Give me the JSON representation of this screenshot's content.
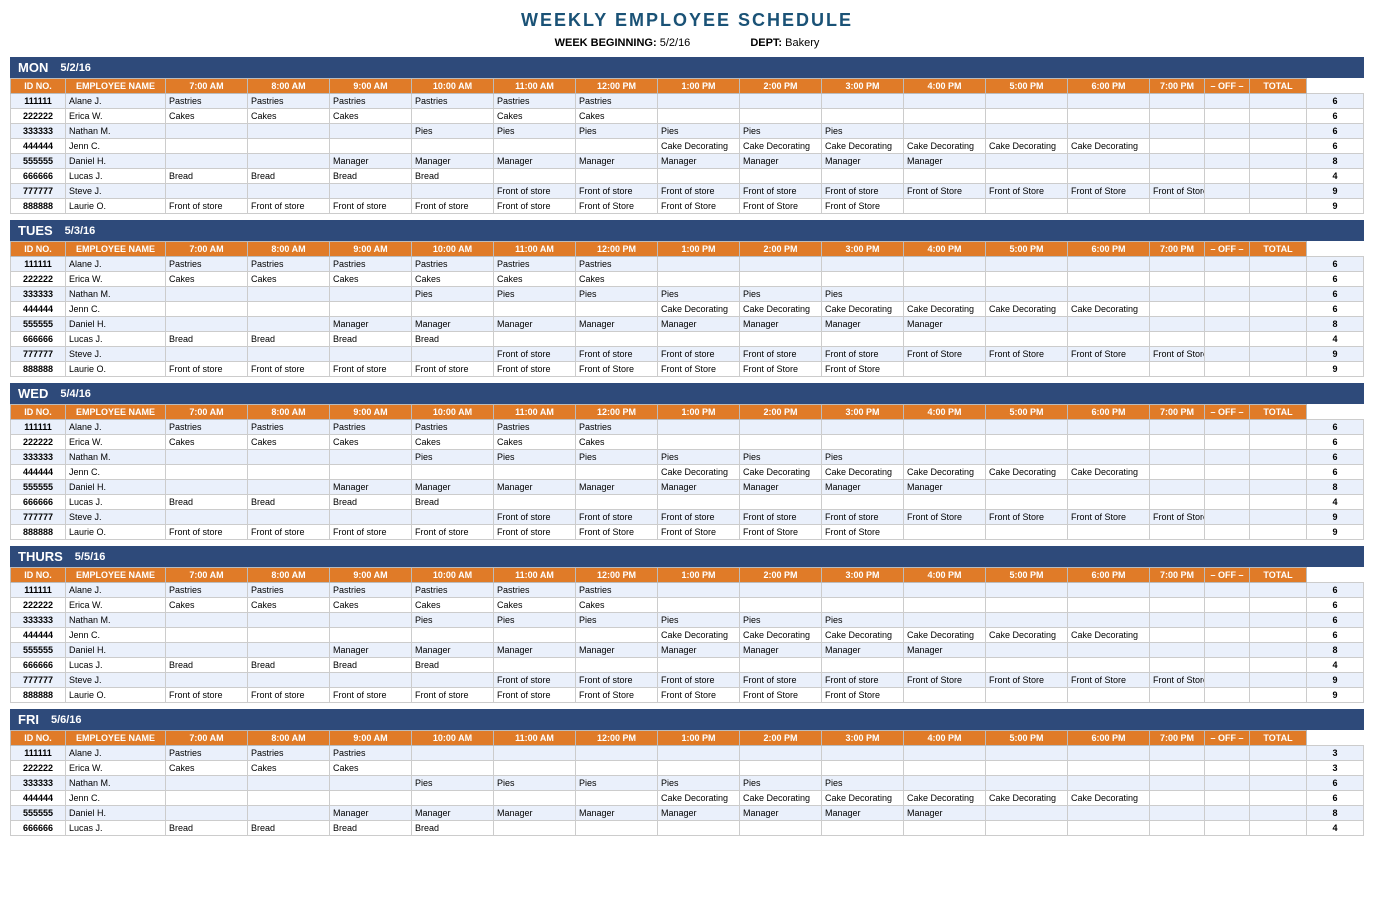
{
  "title": "WEEKLY EMPLOYEE SCHEDULE",
  "meta": {
    "week_label": "WEEK BEGINNING:",
    "week_value": "5/2/16",
    "dept_label": "DEPT:",
    "dept_value": "Bakery"
  },
  "columns": [
    "ID NO.",
    "EMPLOYEE NAME",
    "7:00 AM",
    "8:00 AM",
    "9:00 AM",
    "10:00 AM",
    "11:00 AM",
    "12:00 PM",
    "1:00 PM",
    "2:00 PM",
    "3:00 PM",
    "4:00 PM",
    "5:00 PM",
    "6:00 PM",
    "7:00 PM",
    "– OFF –",
    "TOTAL"
  ],
  "days": [
    {
      "name": "MON",
      "date": "5/2/16",
      "rows": [
        {
          "id": "111111",
          "name": "Alane J.",
          "slots": [
            "Pastries",
            "Pastries",
            "Pastries",
            "Pastries",
            "Pastries",
            "Pastries",
            "",
            "",
            "",
            "",
            "",
            "",
            "",
            ""
          ],
          "off": "",
          "total": "6"
        },
        {
          "id": "222222",
          "name": "Erica W.",
          "slots": [
            "Cakes",
            "Cakes",
            "Cakes",
            "",
            "Cakes",
            "Cakes",
            "",
            "",
            "",
            "",
            "",
            "",
            "",
            ""
          ],
          "off": "",
          "total": "6"
        },
        {
          "id": "333333",
          "name": "Nathan M.",
          "slots": [
            "",
            "",
            "",
            "Pies",
            "Pies",
            "Pies",
            "Pies",
            "Pies",
            "Pies",
            "",
            "",
            "",
            "",
            ""
          ],
          "off": "",
          "total": "6"
        },
        {
          "id": "444444",
          "name": "Jenn C.",
          "slots": [
            "",
            "",
            "",
            "",
            "",
            "",
            "Cake Decorating",
            "Cake Decorating",
            "Cake Decorating",
            "Cake Decorating",
            "Cake Decorating",
            "Cake Decorating",
            "",
            ""
          ],
          "off": "",
          "total": "6"
        },
        {
          "id": "555555",
          "name": "Daniel H.",
          "slots": [
            "",
            "",
            "Manager",
            "Manager",
            "Manager",
            "Manager",
            "Manager",
            "Manager",
            "Manager",
            "Manager",
            "",
            "",
            "",
            ""
          ],
          "off": "",
          "total": "8"
        },
        {
          "id": "666666",
          "name": "Lucas J.",
          "slots": [
            "Bread",
            "Bread",
            "Bread",
            "Bread",
            "",
            "",
            "",
            "",
            "",
            "",
            "",
            "",
            "",
            ""
          ],
          "off": "",
          "total": "4"
        },
        {
          "id": "777777",
          "name": "Steve J.",
          "slots": [
            "",
            "",
            "",
            "",
            "Front of store",
            "Front of store",
            "Front of store",
            "Front of store",
            "Front of store",
            "Front of Store",
            "Front of Store",
            "Front of Store",
            "Front of Store",
            ""
          ],
          "off": "",
          "total": "9"
        },
        {
          "id": "888888",
          "name": "Laurie O.",
          "slots": [
            "Front of store",
            "Front of store",
            "Front of store",
            "Front of store",
            "Front of store",
            "Front of Store",
            "Front of Store",
            "Front of Store",
            "Front of Store",
            "",
            "",
            "",
            "",
            ""
          ],
          "off": "",
          "total": "9"
        }
      ]
    },
    {
      "name": "TUES",
      "date": "5/3/16",
      "rows": [
        {
          "id": "111111",
          "name": "Alane J.",
          "slots": [
            "Pastries",
            "Pastries",
            "Pastries",
            "Pastries",
            "Pastries",
            "Pastries",
            "",
            "",
            "",
            "",
            "",
            "",
            "",
            ""
          ],
          "off": "",
          "total": "6"
        },
        {
          "id": "222222",
          "name": "Erica W.",
          "slots": [
            "Cakes",
            "Cakes",
            "Cakes",
            "Cakes",
            "Cakes",
            "Cakes",
            "",
            "",
            "",
            "",
            "",
            "",
            "",
            ""
          ],
          "off": "",
          "total": "6"
        },
        {
          "id": "333333",
          "name": "Nathan M.",
          "slots": [
            "",
            "",
            "",
            "Pies",
            "Pies",
            "Pies",
            "Pies",
            "Pies",
            "Pies",
            "",
            "",
            "",
            "",
            ""
          ],
          "off": "",
          "total": "6"
        },
        {
          "id": "444444",
          "name": "Jenn C.",
          "slots": [
            "",
            "",
            "",
            "",
            "",
            "",
            "Cake Decorating",
            "Cake Decorating",
            "Cake Decorating",
            "Cake Decorating",
            "Cake Decorating",
            "Cake Decorating",
            "",
            ""
          ],
          "off": "",
          "total": "6"
        },
        {
          "id": "555555",
          "name": "Daniel H.",
          "slots": [
            "",
            "",
            "Manager",
            "Manager",
            "Manager",
            "Manager",
            "Manager",
            "Manager",
            "Manager",
            "Manager",
            "",
            "",
            "",
            ""
          ],
          "off": "",
          "total": "8"
        },
        {
          "id": "666666",
          "name": "Lucas J.",
          "slots": [
            "Bread",
            "Bread",
            "Bread",
            "Bread",
            "",
            "",
            "",
            "",
            "",
            "",
            "",
            "",
            "",
            ""
          ],
          "off": "",
          "total": "4"
        },
        {
          "id": "777777",
          "name": "Steve J.",
          "slots": [
            "",
            "",
            "",
            "",
            "Front of store",
            "Front of store",
            "Front of store",
            "Front of store",
            "Front of store",
            "Front of Store",
            "Front of Store",
            "Front of Store",
            "Front of Store",
            ""
          ],
          "off": "",
          "total": "9"
        },
        {
          "id": "888888",
          "name": "Laurie O.",
          "slots": [
            "Front of store",
            "Front of store",
            "Front of store",
            "Front of store",
            "Front of store",
            "Front of Store",
            "Front of Store",
            "Front of Store",
            "Front of Store",
            "",
            "",
            "",
            "",
            ""
          ],
          "off": "",
          "total": "9"
        }
      ]
    },
    {
      "name": "WED",
      "date": "5/4/16",
      "rows": [
        {
          "id": "111111",
          "name": "Alane J.",
          "slots": [
            "Pastries",
            "Pastries",
            "Pastries",
            "Pastries",
            "Pastries",
            "Pastries",
            "",
            "",
            "",
            "",
            "",
            "",
            "",
            ""
          ],
          "off": "",
          "total": "6"
        },
        {
          "id": "222222",
          "name": "Erica W.",
          "slots": [
            "Cakes",
            "Cakes",
            "Cakes",
            "Cakes",
            "Cakes",
            "Cakes",
            "",
            "",
            "",
            "",
            "",
            "",
            "",
            ""
          ],
          "off": "",
          "total": "6"
        },
        {
          "id": "333333",
          "name": "Nathan M.",
          "slots": [
            "",
            "",
            "",
            "Pies",
            "Pies",
            "Pies",
            "Pies",
            "Pies",
            "Pies",
            "",
            "",
            "",
            "",
            ""
          ],
          "off": "",
          "total": "6"
        },
        {
          "id": "444444",
          "name": "Jenn C.",
          "slots": [
            "",
            "",
            "",
            "",
            "",
            "",
            "Cake Decorating",
            "Cake Decorating",
            "Cake Decorating",
            "Cake Decorating",
            "Cake Decorating",
            "Cake Decorating",
            "",
            ""
          ],
          "off": "",
          "total": "6"
        },
        {
          "id": "555555",
          "name": "Daniel H.",
          "slots": [
            "",
            "",
            "Manager",
            "Manager",
            "Manager",
            "Manager",
            "Manager",
            "Manager",
            "Manager",
            "Manager",
            "",
            "",
            "",
            ""
          ],
          "off": "",
          "total": "8"
        },
        {
          "id": "666666",
          "name": "Lucas J.",
          "slots": [
            "Bread",
            "Bread",
            "Bread",
            "Bread",
            "",
            "",
            "",
            "",
            "",
            "",
            "",
            "",
            "",
            ""
          ],
          "off": "",
          "total": "4"
        },
        {
          "id": "777777",
          "name": "Steve J.",
          "slots": [
            "",
            "",
            "",
            "",
            "Front of store",
            "Front of store",
            "Front of store",
            "Front of store",
            "Front of store",
            "Front of Store",
            "Front of Store",
            "Front of Store",
            "Front of Store",
            ""
          ],
          "off": "",
          "total": "9"
        },
        {
          "id": "888888",
          "name": "Laurie O.",
          "slots": [
            "Front of store",
            "Front of store",
            "Front of store",
            "Front of store",
            "Front of store",
            "Front of Store",
            "Front of Store",
            "Front of Store",
            "Front of Store",
            "",
            "",
            "",
            "",
            ""
          ],
          "off": "",
          "total": "9"
        }
      ]
    },
    {
      "name": "THURS",
      "date": "5/5/16",
      "rows": [
        {
          "id": "111111",
          "name": "Alane J.",
          "slots": [
            "Pastries",
            "Pastries",
            "Pastries",
            "Pastries",
            "Pastries",
            "Pastries",
            "",
            "",
            "",
            "",
            "",
            "",
            "",
            ""
          ],
          "off": "",
          "total": "6"
        },
        {
          "id": "222222",
          "name": "Erica W.",
          "slots": [
            "Cakes",
            "Cakes",
            "Cakes",
            "Cakes",
            "Cakes",
            "Cakes",
            "",
            "",
            "",
            "",
            "",
            "",
            "",
            ""
          ],
          "off": "",
          "total": "6"
        },
        {
          "id": "333333",
          "name": "Nathan M.",
          "slots": [
            "",
            "",
            "",
            "Pies",
            "Pies",
            "Pies",
            "Pies",
            "Pies",
            "Pies",
            "",
            "",
            "",
            "",
            ""
          ],
          "off": "",
          "total": "6"
        },
        {
          "id": "444444",
          "name": "Jenn C.",
          "slots": [
            "",
            "",
            "",
            "",
            "",
            "",
            "Cake Decorating",
            "Cake Decorating",
            "Cake Decorating",
            "Cake Decorating",
            "Cake Decorating",
            "Cake Decorating",
            "",
            ""
          ],
          "off": "",
          "total": "6"
        },
        {
          "id": "555555",
          "name": "Daniel H.",
          "slots": [
            "",
            "",
            "Manager",
            "Manager",
            "Manager",
            "Manager",
            "Manager",
            "Manager",
            "Manager",
            "Manager",
            "",
            "",
            "",
            ""
          ],
          "off": "",
          "total": "8"
        },
        {
          "id": "666666",
          "name": "Lucas J.",
          "slots": [
            "Bread",
            "Bread",
            "Bread",
            "Bread",
            "",
            "",
            "",
            "",
            "",
            "",
            "",
            "",
            "",
            ""
          ],
          "off": "",
          "total": "4"
        },
        {
          "id": "777777",
          "name": "Steve J.",
          "slots": [
            "",
            "",
            "",
            "",
            "Front of store",
            "Front of store",
            "Front of store",
            "Front of store",
            "Front of store",
            "Front of Store",
            "Front of Store",
            "Front of Store",
            "Front of Store",
            ""
          ],
          "off": "",
          "total": "9"
        },
        {
          "id": "888888",
          "name": "Laurie O.",
          "slots": [
            "Front of store",
            "Front of store",
            "Front of store",
            "Front of store",
            "Front of store",
            "Front of Store",
            "Front of Store",
            "Front of Store",
            "Front of Store",
            "",
            "",
            "",
            "",
            ""
          ],
          "off": "",
          "total": "9"
        }
      ]
    },
    {
      "name": "FRI",
      "date": "5/6/16",
      "rows": [
        {
          "id": "111111",
          "name": "Alane J.",
          "slots": [
            "Pastries",
            "Pastries",
            "Pastries",
            "",
            "",
            "",
            "",
            "",
            "",
            "",
            "",
            "",
            "",
            ""
          ],
          "off": "",
          "total": "3"
        },
        {
          "id": "222222",
          "name": "Erica W.",
          "slots": [
            "Cakes",
            "Cakes",
            "Cakes",
            "",
            "",
            "",
            "",
            "",
            "",
            "",
            "",
            "",
            "",
            ""
          ],
          "off": "",
          "total": "3"
        },
        {
          "id": "333333",
          "name": "Nathan M.",
          "slots": [
            "",
            "",
            "",
            "Pies",
            "Pies",
            "Pies",
            "Pies",
            "Pies",
            "Pies",
            "",
            "",
            "",
            "",
            ""
          ],
          "off": "",
          "total": "6"
        },
        {
          "id": "444444",
          "name": "Jenn C.",
          "slots": [
            "",
            "",
            "",
            "",
            "",
            "",
            "Cake Decorating",
            "Cake Decorating",
            "Cake Decorating",
            "Cake Decorating",
            "Cake Decorating",
            "Cake Decorating",
            "",
            ""
          ],
          "off": "",
          "total": "6"
        },
        {
          "id": "555555",
          "name": "Daniel H.",
          "slots": [
            "",
            "",
            "Manager",
            "Manager",
            "Manager",
            "Manager",
            "Manager",
            "Manager",
            "Manager",
            "Manager",
            "",
            "",
            "",
            ""
          ],
          "off": "",
          "total": "8"
        },
        {
          "id": "666666",
          "name": "Lucas J.",
          "slots": [
            "Bread",
            "Bread",
            "Bread",
            "Bread",
            "",
            "",
            "",
            "",
            "",
            "",
            "",
            "",
            "",
            ""
          ],
          "off": "",
          "total": "4"
        }
      ]
    }
  ]
}
